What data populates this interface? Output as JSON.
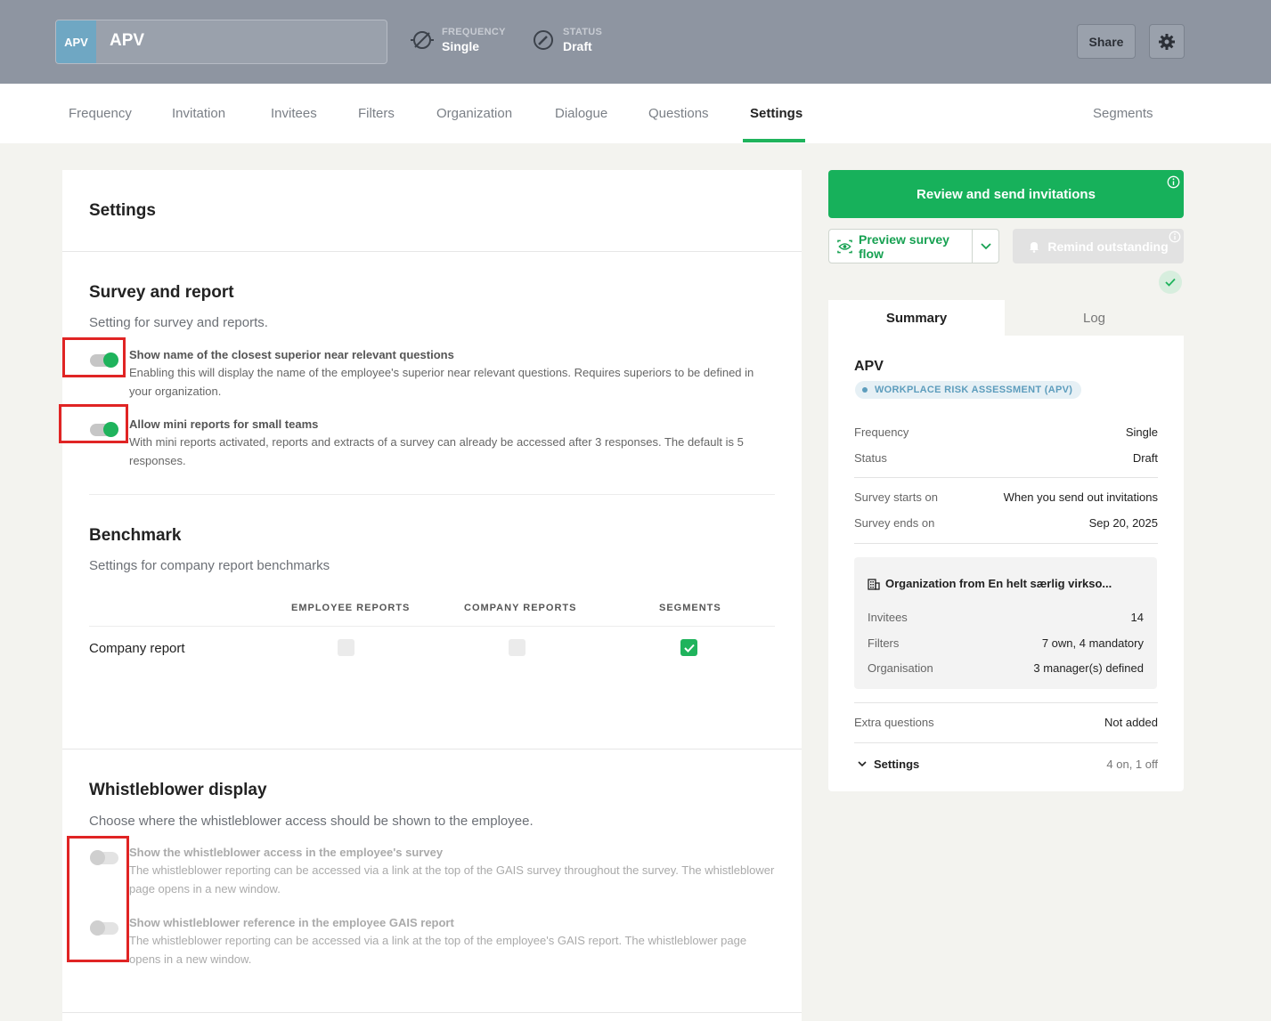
{
  "header": {
    "badge": "APV",
    "title": "APV",
    "frequency": {
      "label": "FREQUENCY",
      "value": "Single"
    },
    "status": {
      "label": "STATUS",
      "value": "Draft"
    },
    "share_label": "Share"
  },
  "tabs": [
    {
      "label": "Frequency"
    },
    {
      "label": "Invitation"
    },
    {
      "label": "Invitees"
    },
    {
      "label": "Filters"
    },
    {
      "label": "Organization"
    },
    {
      "label": "Dialogue"
    },
    {
      "label": "Questions"
    },
    {
      "label": "Settings",
      "active": true
    },
    {
      "label": "Segments"
    }
  ],
  "settings": {
    "title": "Settings",
    "survey_report": {
      "title": "Survey and report",
      "subtitle": "Setting for survey and reports.",
      "options": [
        {
          "title": "Show name of the closest superior near relevant questions",
          "desc": "Enabling this will display the name of the employee's superior near relevant questions. Requires superiors to be defined in your organization.",
          "on": true
        },
        {
          "title": "Allow mini reports for small teams",
          "desc": "With mini reports activated, reports and extracts of a survey can already be accessed after 3 responses. The default is 5 responses.",
          "on": true
        }
      ]
    },
    "benchmark": {
      "title": "Benchmark",
      "subtitle": "Settings for company report benchmarks",
      "columns": [
        "EMPLOYEE REPORTS",
        "COMPANY REPORTS",
        "SEGMENTS"
      ],
      "row_label": "Company report",
      "checks": [
        false,
        false,
        true
      ]
    },
    "whistleblower": {
      "title": "Whistleblower display",
      "subtitle": "Choose where the whistleblower access should be shown to the employee.",
      "options": [
        {
          "title": "Show the whistleblower access in the employee's survey",
          "desc": "The whistleblower reporting can be accessed via a link at the top of the GAIS survey throughout the survey. The whistleblower page opens in a new window.",
          "on": false
        },
        {
          "title": "Show whistleblower reference in the employee GAIS report",
          "desc": "The whistleblower reporting can be accessed via a link at the top of the employee's GAIS report. The whistleblower page opens in a new window.",
          "on": false
        }
      ]
    }
  },
  "actions": {
    "review_label": "Review and send invitations",
    "preview_label": "Preview survey flow",
    "remind_label": "Remind outstanding"
  },
  "summary": {
    "tab_summary": "Summary",
    "tab_log": "Log",
    "name": "APV",
    "type_badge": "WORKPLACE RISK ASSESSMENT (APV)",
    "frequency": {
      "k": "Frequency",
      "v": "Single"
    },
    "status": {
      "k": "Status",
      "v": "Draft"
    },
    "starts": {
      "k": "Survey starts on",
      "v": "When you send out invitations"
    },
    "ends": {
      "k": "Survey ends on",
      "v": "Sep 20, 2025"
    },
    "org": {
      "title": "Organization from En helt særlig virkso...",
      "invitees": {
        "k": "Invitees",
        "v": "14"
      },
      "filters": {
        "k": "Filters",
        "v": "7 own, 4 mandatory"
      },
      "organisation": {
        "k": "Organisation",
        "v": "3 manager(s) defined"
      }
    },
    "extra": {
      "k": "Extra questions",
      "v": "Not added"
    },
    "settings": {
      "k": "Settings",
      "v": "4 on, 1 off"
    }
  },
  "colors": {
    "accent": "#1fb35c",
    "header": "#8e95a1",
    "annotation": "#e02424"
  }
}
